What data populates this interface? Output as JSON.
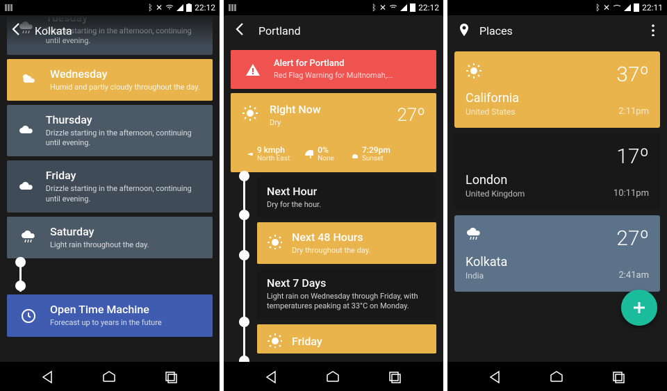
{
  "screen1": {
    "status_time": "22:12",
    "header_title": "Kolkata",
    "days": [
      {
        "name": "Tuesday",
        "desc": "Drizzle starting in the afternoon, continuing until evening.",
        "icon": "rain",
        "bg": "dark-slate2",
        "partial": true
      },
      {
        "name": "Wednesday",
        "desc": "Humid and partly cloudy throughout the day.",
        "icon": "partly",
        "bg": "yellow"
      },
      {
        "name": "Thursday",
        "desc": "Drizzle starting in the afternoon, continuing until evening.",
        "icon": "cloud",
        "bg": "dark-slate"
      },
      {
        "name": "Friday",
        "desc": "Drizzle starting in the afternoon, continuing until evening.",
        "icon": "cloud",
        "bg": "dark-slate2"
      },
      {
        "name": "Saturday",
        "desc": "Light rain throughout the day.",
        "icon": "rain",
        "bg": "dark-slate"
      }
    ],
    "time_machine": {
      "title": "Open Time Machine",
      "desc": "Forecast up to years in the future"
    }
  },
  "screen2": {
    "status_time": "22:12",
    "header_title": "Portland",
    "alert": {
      "title": "Alert for Portland",
      "desc": "Red Flag Warning for Multnomah,..."
    },
    "now": {
      "title": "Right Now",
      "sub": "Dry",
      "temp": "27º",
      "wind_val": "9 kmph",
      "wind_label": "North East",
      "precip_val": "0%",
      "precip_label": "None",
      "sunset_val": "7:29pm",
      "sunset_label": "Sunset"
    },
    "segments": [
      {
        "title": "Next Hour",
        "desc": "Dry for the hour.",
        "bg": "very-dark",
        "icon": "none"
      },
      {
        "title": "Next 48 Hours",
        "desc": "Dry throughout the day.",
        "bg": "yellow",
        "icon": "sun"
      },
      {
        "title": "Next 7 Days",
        "desc": "Light rain on Wednesday through Friday, with temperatures peaking at 33°C on Monday.",
        "bg": "very-dark",
        "icon": "none"
      },
      {
        "title": "Friday",
        "desc": "",
        "bg": "yellow",
        "icon": "sun"
      }
    ]
  },
  "screen3": {
    "status_time": "22:11",
    "header_title": "Places",
    "places": [
      {
        "name": "California",
        "country": "United States",
        "temp": "37º",
        "time": "2:11pm",
        "bg": "yellow",
        "icon": "sun"
      },
      {
        "name": "London",
        "country": "United Kingdom",
        "temp": "17º",
        "time": "10:11pm",
        "bg": "very-dark",
        "icon": "moon"
      },
      {
        "name": "Kolkata",
        "country": "India",
        "temp": "27º",
        "time": "2:41am",
        "bg": "slate-blue",
        "icon": "rain"
      }
    ]
  }
}
